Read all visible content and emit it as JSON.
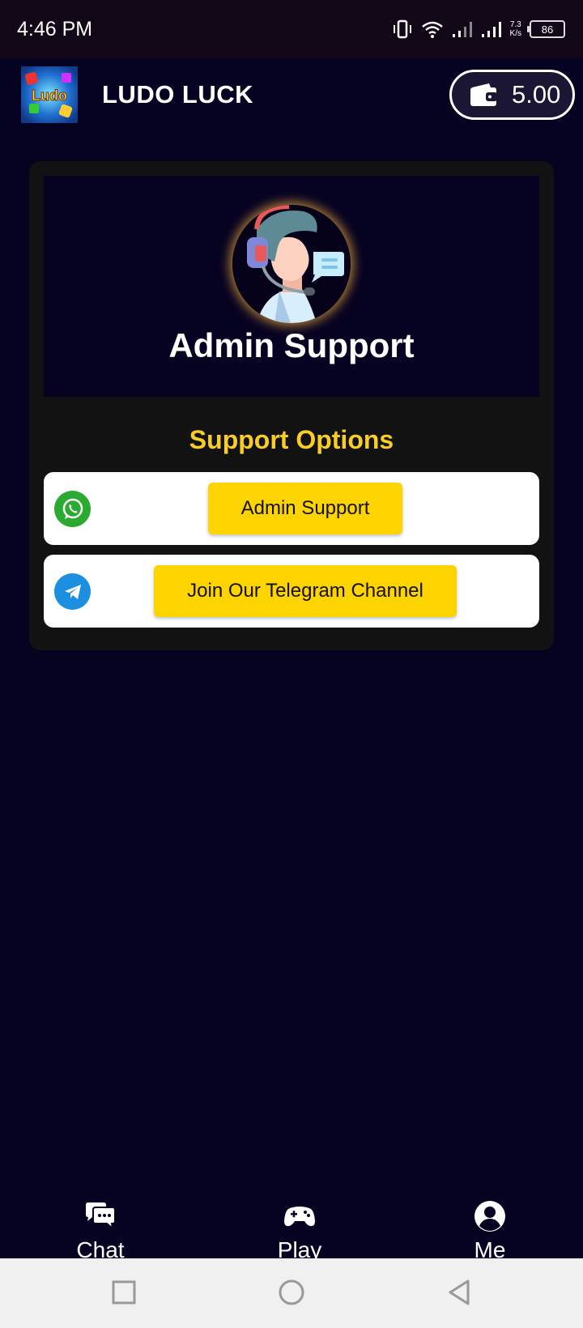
{
  "status_bar": {
    "time": "4:46 PM",
    "net_speed_value": "7.3",
    "net_speed_unit": "K/s",
    "battery": "86"
  },
  "header": {
    "app_title": "LUDO LUCK",
    "logo_text": "Ludo",
    "wallet_amount": "5.00",
    "wallet_icon": "wallet-icon"
  },
  "hero": {
    "title": "Admin Support",
    "avatar_icon": "support-agent-icon"
  },
  "support": {
    "heading": "Support Options",
    "options": [
      {
        "icon": "whatsapp-icon",
        "label": "Admin Support"
      },
      {
        "icon": "telegram-icon",
        "label": "Join Our Telegram Channel"
      }
    ]
  },
  "bottom_nav": {
    "items": [
      {
        "icon": "chat-icon",
        "label": "Chat"
      },
      {
        "icon": "gamepad-icon",
        "label": "Play"
      },
      {
        "icon": "user-icon",
        "label": "Me"
      }
    ]
  },
  "colors": {
    "background": "#060221",
    "card": "#121212",
    "accent_yellow": "#fdd300",
    "heading_yellow": "#f8cd25",
    "whatsapp_green": "#2aaa30",
    "telegram_blue": "#1c8fe0"
  }
}
